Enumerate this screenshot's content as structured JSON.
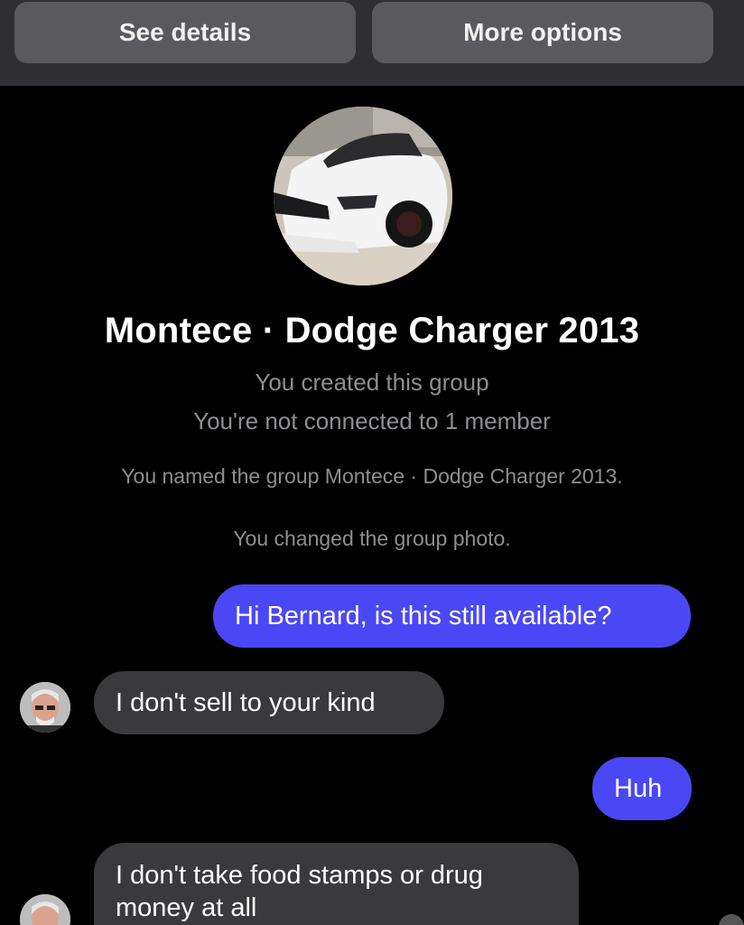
{
  "toolbar": {
    "see_details": "See details",
    "more_options": "More options"
  },
  "group": {
    "name": "Montece · Dodge Charger 2013",
    "created_note": "You created this group",
    "connection_note": "You're not connected to 1 member"
  },
  "system_messages": [
    "You named the group Montece · Dodge Charger 2013.",
    "You changed the group photo."
  ],
  "messages": [
    {
      "direction": "outgoing",
      "text": "Hi Bernard, is this still available?"
    },
    {
      "direction": "incoming",
      "text": "I don't sell to your kind"
    },
    {
      "direction": "outgoing",
      "text": "Huh"
    },
    {
      "direction": "incoming",
      "text": "I don't take food stamps or drug money at all"
    }
  ],
  "colors": {
    "outgoing_bubble": "#4a48f5",
    "incoming_bubble": "#3a3a3c",
    "background": "#000000",
    "secondary_text": "#8e8e93"
  }
}
